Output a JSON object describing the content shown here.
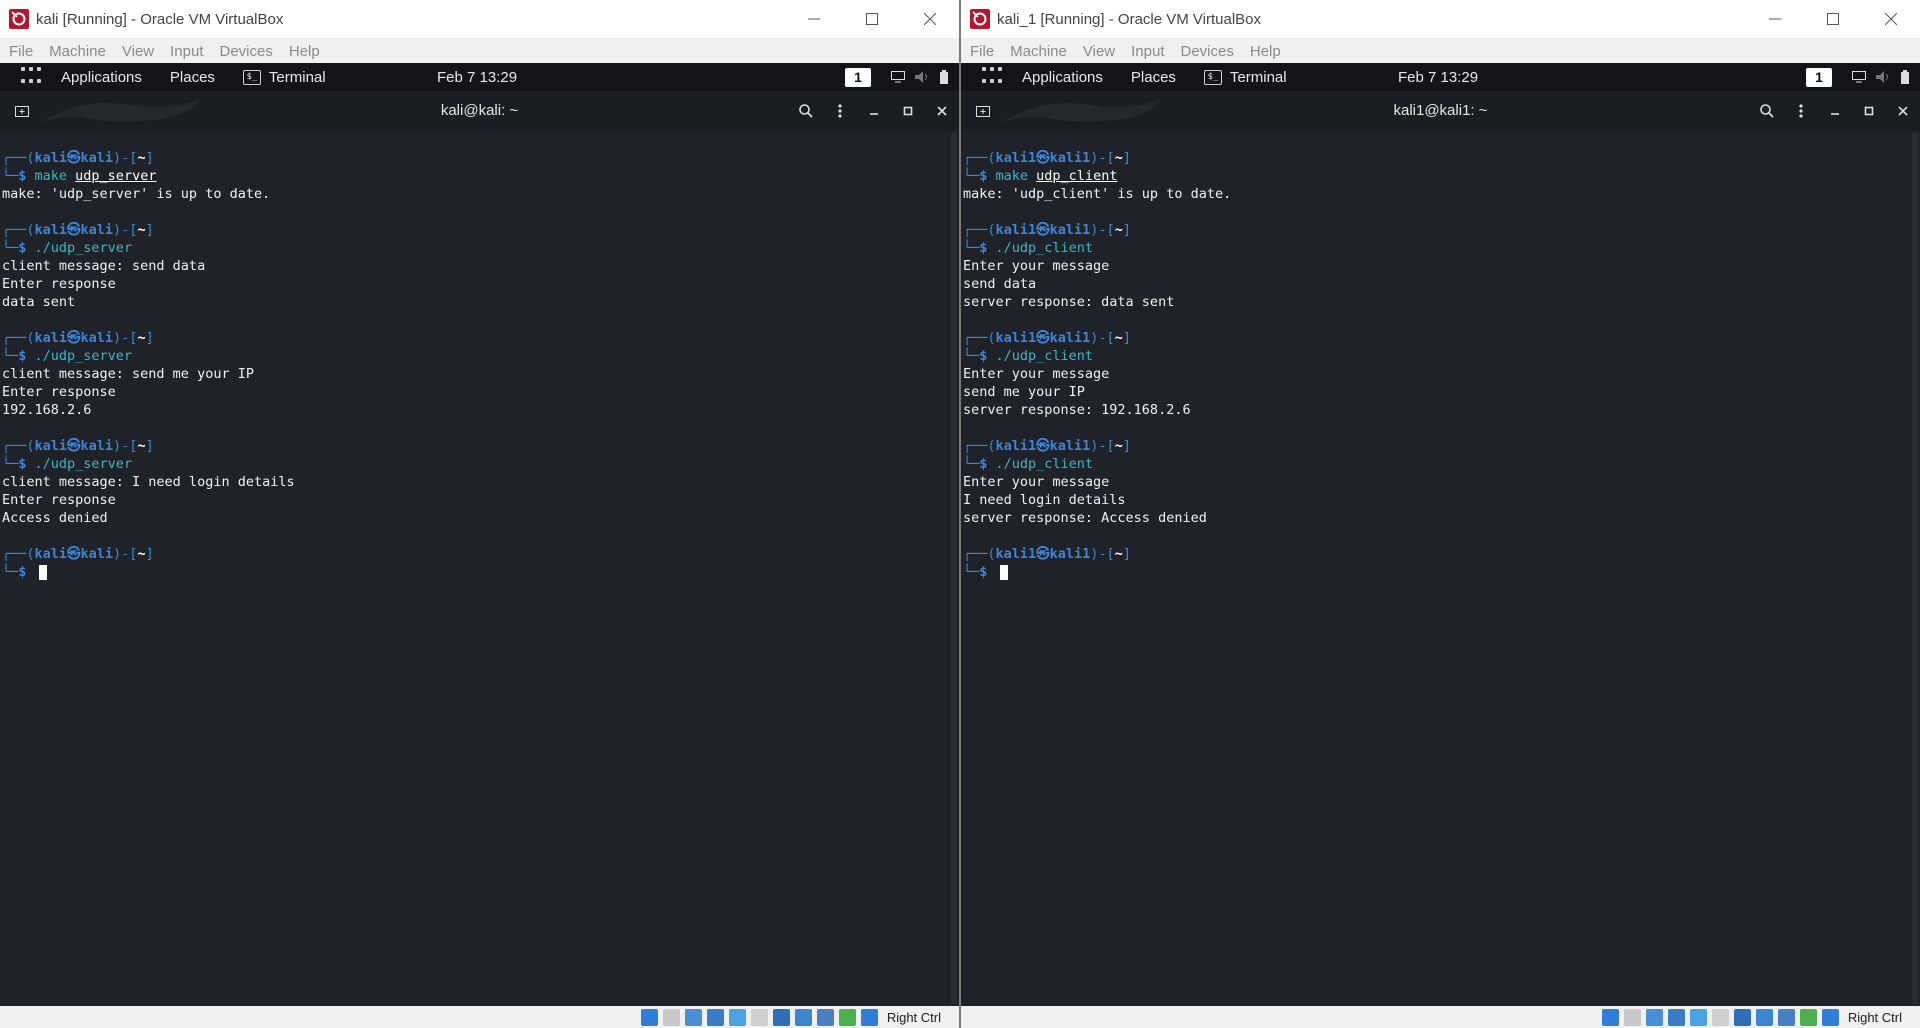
{
  "left": {
    "window_title": "kali [Running] - Oracle VM VirtualBox",
    "menu": [
      "File",
      "Machine",
      "View",
      "Input",
      "Devices",
      "Help"
    ],
    "panel": {
      "applications": "Applications",
      "places": "Places",
      "terminal": "Terminal",
      "clock": "Feb 7  13:29",
      "workspace": "1"
    },
    "terminal_title": "kali@kali: ~",
    "prompt": {
      "user": "kali",
      "sep": "㉿",
      "host": "kali"
    },
    "blocks": [
      {
        "cmd_prefix": "make ",
        "cmd_arg": "udp_server",
        "output": [
          "make: 'udp_server' is up to date."
        ]
      },
      {
        "cmd_prefix": "./udp_server",
        "cmd_arg": "",
        "output": [
          "client message: send data",
          "Enter response",
          "data sent"
        ]
      },
      {
        "cmd_prefix": "./udp_server",
        "cmd_arg": "",
        "output": [
          "client message: send me your IP",
          "Enter response",
          "192.168.2.6"
        ]
      },
      {
        "cmd_prefix": "./udp_server",
        "cmd_arg": "",
        "output": [
          "client message: I need login details",
          "Enter response",
          "Access denied"
        ]
      }
    ],
    "host_key": "Right Ctrl"
  },
  "right": {
    "window_title": "kali_1 [Running] - Oracle VM VirtualBox",
    "menu": [
      "File",
      "Machine",
      "View",
      "Input",
      "Devices",
      "Help"
    ],
    "panel": {
      "applications": "Applications",
      "places": "Places",
      "terminal": "Terminal",
      "clock": "Feb 7  13:29",
      "workspace": "1"
    },
    "terminal_title": "kali1@kali1: ~",
    "prompt": {
      "user": "kali1",
      "sep": "㉿",
      "host": "kali1"
    },
    "blocks": [
      {
        "cmd_prefix": "make ",
        "cmd_arg": "udp_client",
        "output": [
          "make: 'udp_client' is up to date."
        ]
      },
      {
        "cmd_prefix": "./udp_client",
        "cmd_arg": "",
        "output": [
          "Enter your message",
          "send data",
          "server response: data sent"
        ]
      },
      {
        "cmd_prefix": "./udp_client",
        "cmd_arg": "",
        "output": [
          "Enter your message",
          "send me your IP",
          "server response: 192.168.2.6"
        ]
      },
      {
        "cmd_prefix": "./udp_client",
        "cmd_arg": "",
        "output": [
          "Enter your message",
          "I need login details",
          "server response: Access denied"
        ]
      }
    ],
    "host_key": "Right Ctrl"
  },
  "colors": {
    "prompt_blue": "#3d86d5",
    "command_cyan": "#38b8c4",
    "terminal_bg": "#1f2229",
    "panel_bg": "#131418"
  },
  "status_icons": [
    "disk-icon",
    "optical-icon",
    "audio-icon",
    "network-icon",
    "usb-icon",
    "shared-folder-icon",
    "display-icon",
    "recording-icon",
    "cpu-icon",
    "mouse-integration-icon",
    "keyboard-capture-icon"
  ]
}
